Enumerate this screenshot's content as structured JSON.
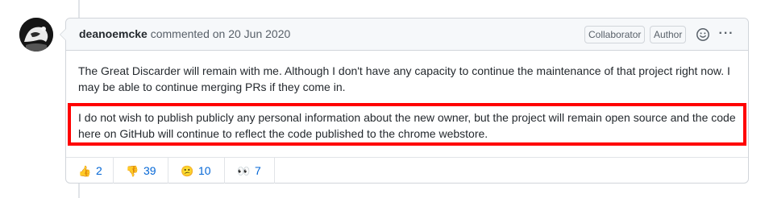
{
  "comment": {
    "author": "deanoemcke",
    "action": "commented on 20 Jun 2020",
    "badges": [
      "Collaborator",
      "Author"
    ],
    "icons": {
      "avatar": "user-avatar",
      "emoji": "smiley-icon",
      "more": "kebab-horizontal-icon"
    },
    "more_label": "···",
    "paragraphs": [
      "The Great Discarder will remain with me. Although I don't have any capacity to continue the maintenance of that project right now. I may be able to continue merging PRs if they come in.",
      "I do not wish to publish publicly any personal information about the new owner, but the project will remain open source and the code here on GitHub will continue to reflect the code published to the chrome webstore."
    ],
    "highlight_color": "#ff0000",
    "reactions": [
      {
        "emoji": "👍",
        "name": "thumbs-up-icon",
        "count": "2"
      },
      {
        "emoji": "👎",
        "name": "thumbs-down-icon",
        "count": "39"
      },
      {
        "emoji": "😕",
        "name": "confused-icon",
        "count": "10"
      },
      {
        "emoji": "👀",
        "name": "eyes-icon",
        "count": "7"
      }
    ]
  }
}
